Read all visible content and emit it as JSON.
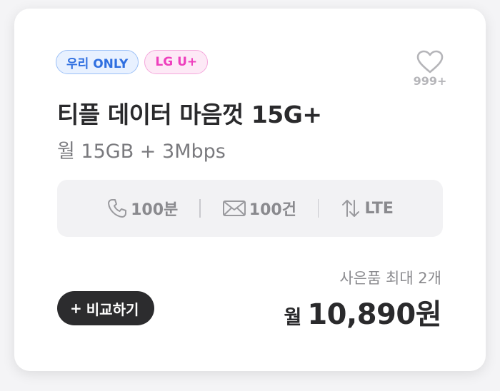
{
  "badges": [
    {
      "label": "우리 ONLY"
    },
    {
      "label": "LG U+"
    }
  ],
  "favorite": {
    "count": "999+"
  },
  "plan": {
    "title": "티플 데이터 마음껏 15G+",
    "subtitle": "월 15GB + 3Mbps"
  },
  "specs": [
    {
      "icon": "phone-icon",
      "value": "100분"
    },
    {
      "icon": "mail-icon",
      "value": "100건"
    },
    {
      "icon": "network-arrows-icon",
      "value": "LTE"
    }
  ],
  "gift": "사은품 최대 2개",
  "price": {
    "prefix": "월",
    "value": "10,890원"
  },
  "compare_button": {
    "plus": "+",
    "label": "비교하기"
  },
  "colors": {
    "badge_blue": "#2f6fe0",
    "badge_pink": "#ee3fbd",
    "button_dark": "#2c2c2e",
    "spec_bg": "#f2f2f4"
  }
}
